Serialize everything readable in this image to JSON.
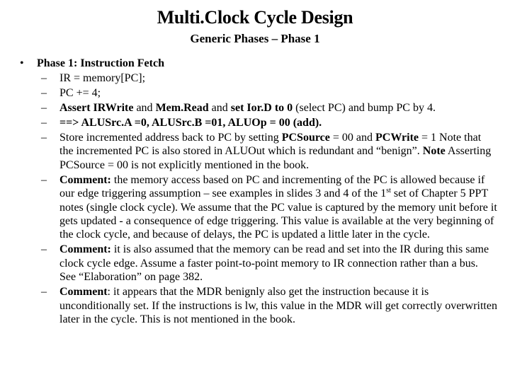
{
  "slide": {
    "title": "Multi.Clock Cycle Design",
    "subtitle": "Generic Phases – Phase 1",
    "bullet_glyph": "•",
    "dash_glyph": "–",
    "phase_heading": "Phase 1: Instruction Fetch",
    "items": [
      {
        "segments": [
          {
            "text": "IR = memory[PC];",
            "bold": false
          }
        ]
      },
      {
        "segments": [
          {
            "text": "PC += 4;",
            "bold": false
          }
        ]
      },
      {
        "segments": [
          {
            "text": "Assert IRWrite",
            "bold": true
          },
          {
            "text": " and ",
            "bold": false
          },
          {
            "text": "Mem.Read",
            "bold": true
          },
          {
            "text": " and ",
            "bold": false
          },
          {
            "text": "set Ior.D to 0",
            "bold": true
          },
          {
            "text": " (select PC) and bump PC by 4.",
            "bold": false
          }
        ]
      },
      {
        "segments": [
          {
            "text": "==> ALUSrc.A =0, ALUSrc.B =01,  ALUOp = 00 (add).",
            "bold": true
          }
        ]
      },
      {
        "segments": [
          {
            "text": "Store incremented address back to PC by setting ",
            "bold": false
          },
          {
            "text": "PCSource",
            "bold": true
          },
          {
            "text": " = 00",
            "bold": false
          },
          {
            "text": "",
            "bold": false
          },
          {
            "text": " and ",
            "bold": false
          },
          {
            "text": "PCWrite",
            "bold": true
          },
          {
            "text": " = 1",
            "bold": false
          },
          {
            "text": " Note that the incremented PC is also stored in ALUOut which is redundant and “benign”.   ",
            "bold": false
          },
          {
            "text": "Note",
            "bold": true
          },
          {
            "text": " Asserting PCSource = 00 is not explicitly mentioned in the book.",
            "bold": false
          }
        ]
      },
      {
        "segments": [
          {
            "text": "Comment:",
            "bold": true
          },
          {
            "text": " the memory access based on PC and incrementing of the PC is allowed because if our edge triggering assumption – see examples in slides 3 and 4 of the 1",
            "bold": false
          },
          {
            "text": "st",
            "bold": false,
            "sup": true
          },
          {
            "text": " set of Chapter 5 PPT notes (single clock cycle).  We assume that the PC value is captured by the memory unit before it gets updated - a consequence of edge triggering.  This value is available at the very beginning of the clock cycle, and because of delays, the PC is updated a little later in the cycle.",
            "bold": false
          }
        ]
      },
      {
        "segments": [
          {
            "text": "Comment:",
            "bold": true
          },
          {
            "text": " it is also assumed that the memory can be read and set into the IR during this same clock cycle edge.  Assume a faster point-to-point memory to IR connection rather than a bus.  See “Elaboration” on page 382.",
            "bold": false
          }
        ]
      },
      {
        "segments": [
          {
            "text": "Comment",
            "bold": true
          },
          {
            "text": ": it appears that the MDR benignly also get the instruction because it is unconditionally set.  If the instructions is lw, this value in the MDR will get correctly overwritten later in the cycle.  This is not mentioned in the book.",
            "bold": false
          }
        ]
      }
    ]
  }
}
